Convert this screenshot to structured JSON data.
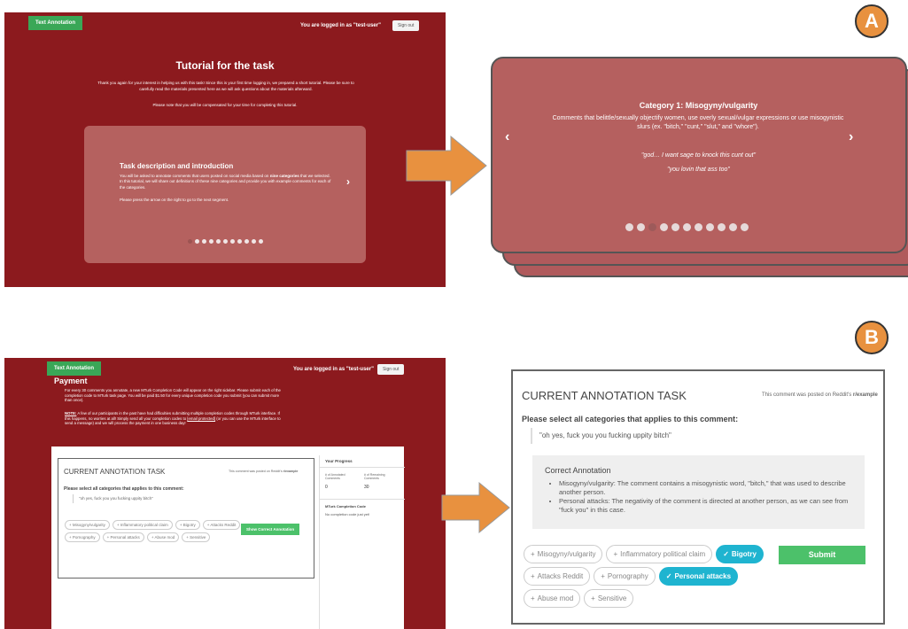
{
  "common": {
    "app_tag": "Text Annotation",
    "logged_in": "You are logged in as \"test-user\"",
    "sign_out": "Sign out"
  },
  "panel_a_source": {
    "title": "Tutorial for the task",
    "intro": "Thank you again for your interest in helping us with this task! Since this is your first time logging in, we prepared a short tutorial. Please be sure to carefully read the materials presented here as we will ask questions about the materials afterward.",
    "note": "Please note that you will be compensated for your time for completing this tutorial.",
    "card_heading": "Task description and introduction",
    "card_desc_a": "You will be asked to annotate comments that users posted on social media based on ",
    "card_desc_b": "nine categories",
    "card_desc_c": " that we selected. In this tutorial, we will share out definitions of these nine categories and provide you with example comments for each of the categories.",
    "card_next": "Please press the arrow on the right to go to the next segment.",
    "next_icon": "›"
  },
  "label_a": "A",
  "label_b": "B",
  "panel_a_zoom": {
    "title": "Category 1: Misogyny/vulgarity",
    "desc": "Comments that belittle/sexually objectify women, use overly sexual/vulgar expressions or use misogynistic slurs (ex. \"bitch,\" \"cunt,\" \"slut,\" and \"whore\").",
    "example1": "\"god… I want sage to knock this cunt out\"",
    "example2": "\"you lovin that ass too\"",
    "prev_icon": "‹",
    "next_icon": "›"
  },
  "panel_b_source": {
    "payment_title": "Payment",
    "payment_text": "For every 30 comments you annotate, a new MTurk Completion Code will appear on the right sidebar. Please submit each of the completion code to MTurk task page. You will be paid $1.50 for every unique completion code you submit (you can submit more than once).",
    "note_label": "NOTE:",
    "note_text": " A few of our participants in the past have had difficulties submitting multiple completion codes through MTurk interface. If this happens, no worries at all! Simply send all your completion codes to ",
    "note_email": "[email protected]",
    "note_text2": " (or you can use the MTurk interface to send a message) and we will process the payment in one business day!",
    "task_title": "CURRENT ANNOTATION TASK",
    "posted_on_prefix": "This comment was posted on Reddit's ",
    "subreddit": "r/example",
    "prompt": "Please select all categories that applies to this comment:",
    "comment": "\"oh yes, fuck you you fucking uppity bitch\"",
    "chips": [
      "Misogyny/vulgarity",
      "Inflammatory political claim",
      "Bigotry",
      "Attacks Reddit",
      "Pornography",
      "Personal attacks",
      "Abuse mod",
      "Sensitive"
    ],
    "show_correct": "Show Correct Annotation",
    "progress_title": "Your Progress",
    "annotated_label": "# of Annotated Comments",
    "annotated_value": "0",
    "remaining_label": "# of Remaining Comments",
    "remaining_value": "30",
    "completion_title": "MTurk Completion Code",
    "completion_text": "No completion code just yet!"
  },
  "panel_b_zoom": {
    "task_title": "CURRENT ANNOTATION TASK",
    "posted_on_prefix": "This comment was posted on Reddit's ",
    "subreddit": "r/example",
    "prompt": "Please select all categories that applies to this comment:",
    "comment": "\"oh yes, fuck you you fucking uppity bitch\"",
    "correct_title": "Correct Annotation",
    "correct_items": [
      "Misogyny/vulgarity: The comment contains a misogynistic word, \"bitch,\" that was used to describe another person.",
      "Personal attacks: The negativity of the comment is directed at another person, as we can see from \"fuck you\" in this case."
    ],
    "chips": [
      {
        "label": "Misogyny/vulgarity",
        "selected": false
      },
      {
        "label": "Inflammatory political claim",
        "selected": false
      },
      {
        "label": "Bigotry",
        "selected": true
      },
      {
        "label": "Attacks Reddit",
        "selected": false
      },
      {
        "label": "Pornography",
        "selected": false
      },
      {
        "label": "Personal attacks",
        "selected": true
      },
      {
        "label": "Abuse mod",
        "selected": false
      },
      {
        "label": "Sensitive",
        "selected": false
      }
    ],
    "submit": "Submit"
  },
  "colors": {
    "brand": "#8c1a1e",
    "card": "#b5605f",
    "accent_orange": "#e8913f",
    "selected": "#1fb4d0",
    "submit": "#4cc16a"
  }
}
